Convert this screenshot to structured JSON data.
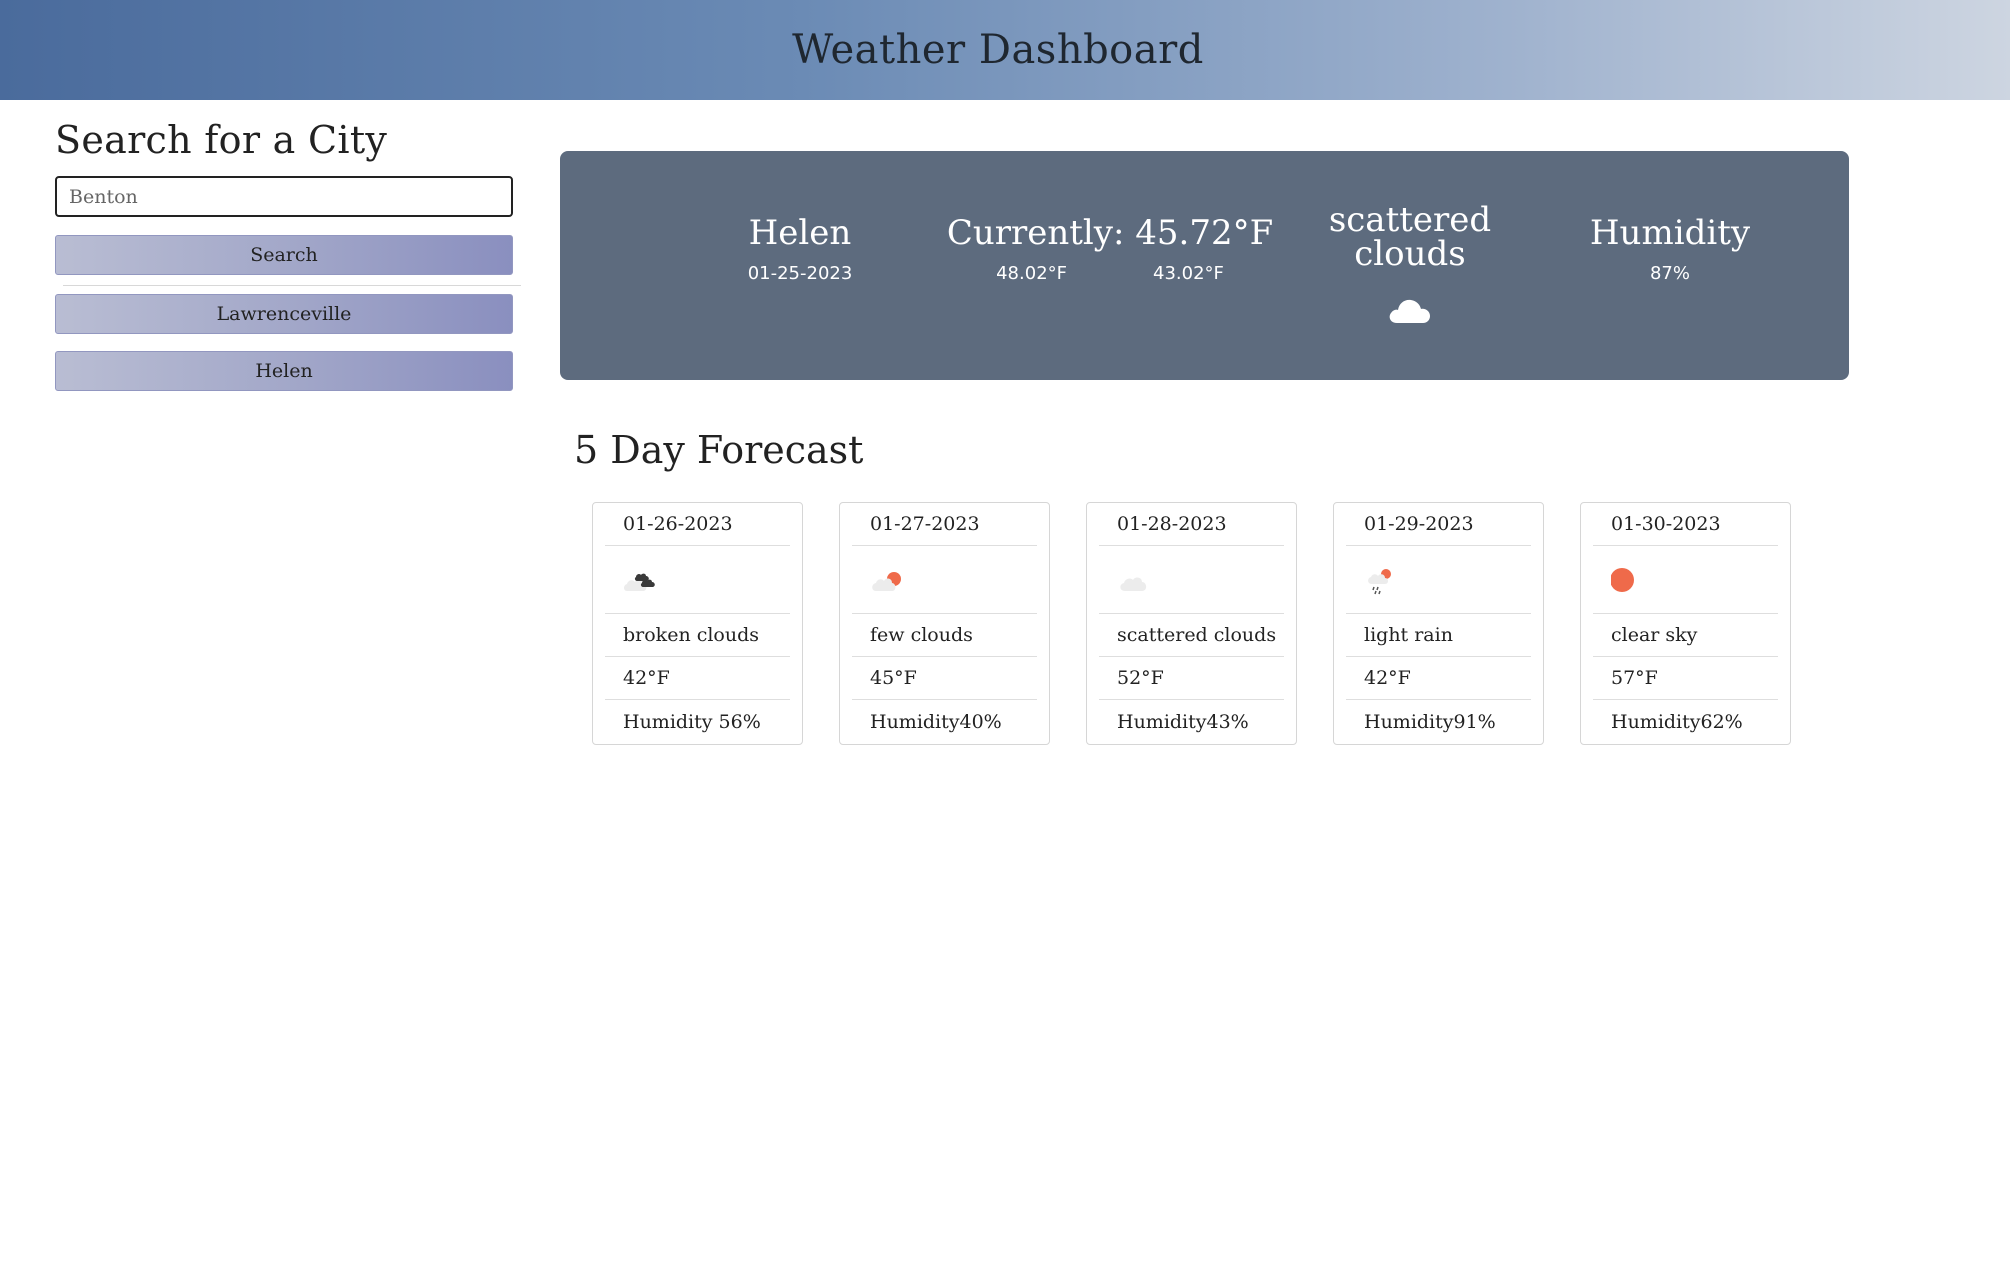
{
  "header": {
    "title": "Weather Dashboard"
  },
  "sidebar": {
    "heading": "Search for a City",
    "search_placeholder": "Benton",
    "search_value": "",
    "search_button": "Search",
    "history": [
      "Lawrenceville",
      "Helen"
    ]
  },
  "current": {
    "city": "Helen",
    "date": "01-25-2023",
    "temp_label": "Currently: 45.72°F",
    "high": "48.02°F",
    "low": "43.02°F",
    "desc_line1": "scattered",
    "desc_line2": "clouds",
    "icon": "cloud-icon",
    "humidity_label": "Humidity",
    "humidity": "87%"
  },
  "forecast": {
    "title": "5 Day Forecast",
    "days": [
      {
        "date": "01-26-2023",
        "icon": "broken-clouds-icon",
        "desc": "broken clouds",
        "temp": "42°F",
        "humidity": "Humidity 56%"
      },
      {
        "date": "01-27-2023",
        "icon": "few-clouds-icon",
        "desc": "few clouds",
        "temp": "45°F",
        "humidity": "Humidity40%"
      },
      {
        "date": "01-28-2023",
        "icon": "scattered-clouds-icon",
        "desc": "scattered clouds",
        "temp": "52°F",
        "humidity": "Humidity43%"
      },
      {
        "date": "01-29-2023",
        "icon": "light-rain-icon",
        "desc": "light rain",
        "temp": "42°F",
        "humidity": "Humidity91%"
      },
      {
        "date": "01-30-2023",
        "icon": "clear-sky-icon",
        "desc": "clear sky",
        "temp": "57°F",
        "humidity": "Humidity62%"
      }
    ]
  },
  "colors": {
    "sun": "#ef6a4a",
    "cloud_light": "#e9e9e9",
    "cloud_dark": "#3a3a3a",
    "panel": "#5d6b7e"
  }
}
